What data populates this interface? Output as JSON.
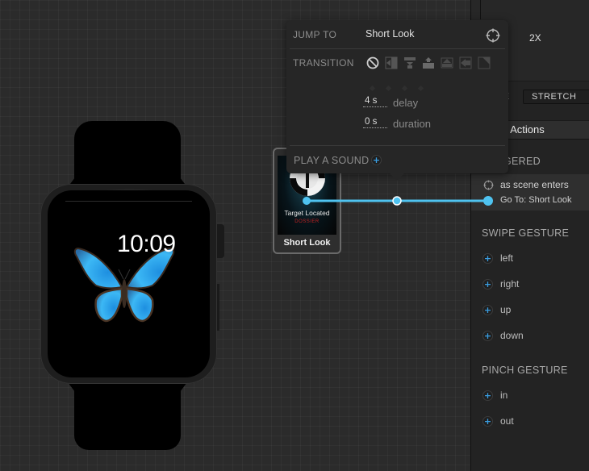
{
  "watch": {
    "time": "10:09",
    "wallpaper_icon": "butterfly-icon"
  },
  "scene_node": {
    "thumbnail_title": "Target Located",
    "thumbnail_subtitle": "DOSSIER",
    "label": "Short Look"
  },
  "popover": {
    "jump_to_label": "JUMP TO",
    "jump_to_value": "Short Look",
    "transition_label": "TRANSITION",
    "transitions": [
      {
        "name": "none",
        "icon": "no-transition-icon",
        "selected": true
      },
      {
        "name": "push-left",
        "icon": "push-left-icon",
        "selected": false
      },
      {
        "name": "slide-down",
        "icon": "slide-down-icon",
        "selected": false
      },
      {
        "name": "slide-up",
        "icon": "slide-up-icon",
        "selected": false
      },
      {
        "name": "cover-up",
        "icon": "cover-up-icon",
        "selected": false
      },
      {
        "name": "push-back",
        "icon": "push-back-icon",
        "selected": false
      },
      {
        "name": "page-curl",
        "icon": "page-curl-icon",
        "selected": false
      }
    ],
    "delay_value": "4 s",
    "delay_label": "delay",
    "duration_value": "0 s",
    "duration_label": "duration",
    "sound_label": "PLAY A SOUND"
  },
  "inspector": {
    "scale_label": "2X",
    "mode_partial_label": "E",
    "resize_mode": "STRETCH",
    "section_title": "e Actions",
    "triggered_header": "GERED",
    "triggered": {
      "event": "as scene enters",
      "action": "Go To: Short Look"
    },
    "swipe_header": "SWIPE GESTURE",
    "swipe_items": [
      "left",
      "right",
      "up",
      "down"
    ],
    "pinch_header": "PINCH GESTURE",
    "pinch_items": [
      "in",
      "out"
    ]
  },
  "colors": {
    "accent": "#4fc3f0",
    "plus_blue": "#3a9de0",
    "dossier_red": "#c02020"
  }
}
